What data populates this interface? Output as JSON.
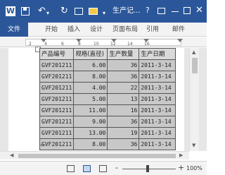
{
  "window": {
    "app_logo": "W",
    "title": "生产记...",
    "help": "?"
  },
  "icons": {
    "app": "word-logo-icon",
    "save": "save-icon",
    "undo": "undo-icon",
    "redo": "redo-icon",
    "print": "print-icon",
    "open": "folder-icon",
    "minimize": "minimize-icon",
    "maximize": "maximize-icon",
    "close": "close-icon"
  },
  "ribbon": {
    "tabs": [
      "文件",
      "开始",
      "插入",
      "设计",
      "页面布局",
      "引用",
      "邮件"
    ],
    "collapse": "^"
  },
  "ruler": {
    "numbers": [
      "2",
      "4",
      "6",
      "8",
      "10",
      "12",
      "14",
      "16"
    ]
  },
  "table": {
    "headers": [
      "产品编号",
      "规格(直径)",
      "生产数量",
      "生产日期"
    ],
    "rows": [
      [
        "GVF201211",
        "6.00",
        "36",
        "2011-3-14"
      ],
      [
        "GVF201211",
        "8.00",
        "36",
        "2011-3-14"
      ],
      [
        "GVF201211",
        "4.00",
        "22",
        "2011-3-14"
      ],
      [
        "GVF201211",
        "5.00",
        "13",
        "2011-3-14"
      ],
      [
        "GVF201211",
        "11.00",
        "16",
        "2011-3-14"
      ],
      [
        "GVF201211",
        "9.00",
        "36",
        "2011-3-14"
      ],
      [
        "GVF201211",
        "13.00",
        "19",
        "2011-3-14"
      ],
      [
        "GVF201211",
        "8.00",
        "36",
        "2011-3-14"
      ]
    ]
  },
  "status": {
    "zoom_minus": "-",
    "zoom_plus": "+",
    "zoom_level": "100%",
    "zoom_fraction": 0.5
  },
  "colors": {
    "title_bar": "#2b579a",
    "cell_fill": "#c8c8c8",
    "header_fill": "#d9d9d9"
  }
}
